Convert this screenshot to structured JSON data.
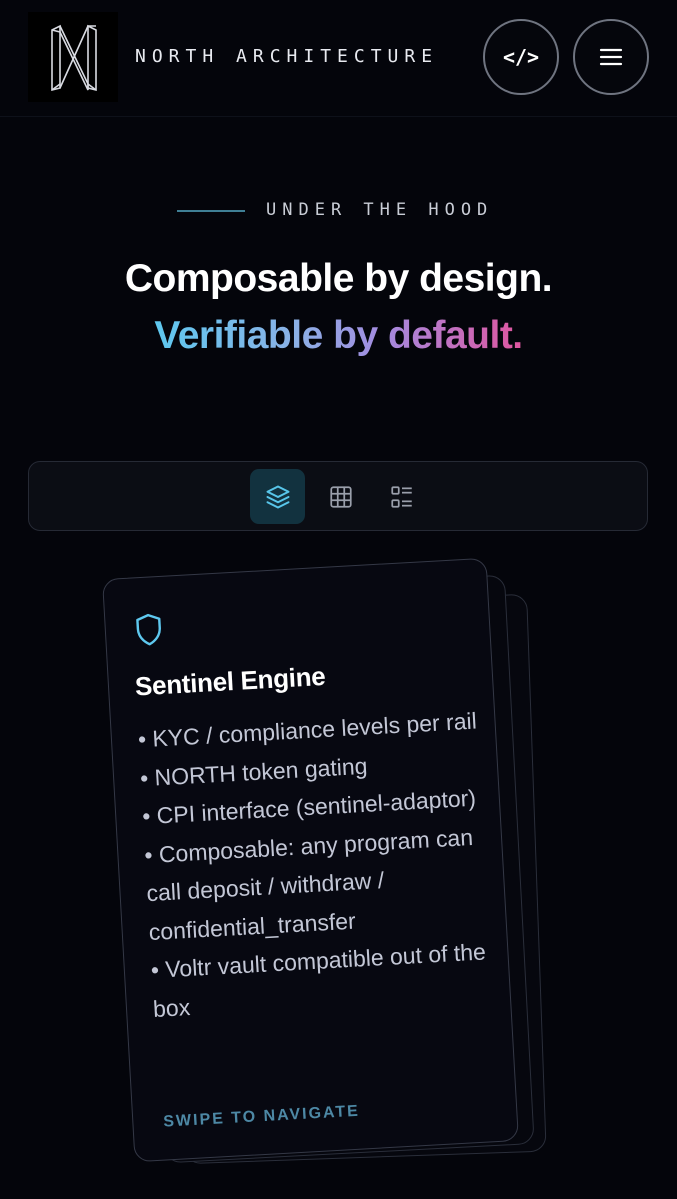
{
  "header": {
    "brand": "NORTH ARCHITECTURE",
    "logo_icon": "north-n-logo",
    "code_button_label": "</>",
    "menu_icon": "hamburger-icon"
  },
  "hero": {
    "eyebrow": "UNDER THE HOOD",
    "title_line1": "Composable by design.",
    "title_line2": "Verifiable by default."
  },
  "view_toolbar": {
    "options": [
      {
        "icon": "layers-icon",
        "active": true
      },
      {
        "icon": "grid-icon",
        "active": false
      },
      {
        "icon": "list-icon",
        "active": false
      }
    ]
  },
  "card": {
    "icon": "shield-icon",
    "title": "Sentinel Engine",
    "bullets": [
      "• KYC / compliance levels per rail",
      "• NORTH token gating",
      "• CPI interface (sentinel-adaptor)",
      "• Composable: any program can call deposit / withdraw / confidential_transfer",
      "• Voltr vault compatible out of the box"
    ],
    "hint": "SWIPE TO NAVIGATE"
  },
  "colors": {
    "background": "#04050b",
    "accent_cyan": "#5ec8ef",
    "accent_purple": "#a48be0",
    "accent_pink": "#e0559f",
    "active_toolbar": "#12323f"
  }
}
